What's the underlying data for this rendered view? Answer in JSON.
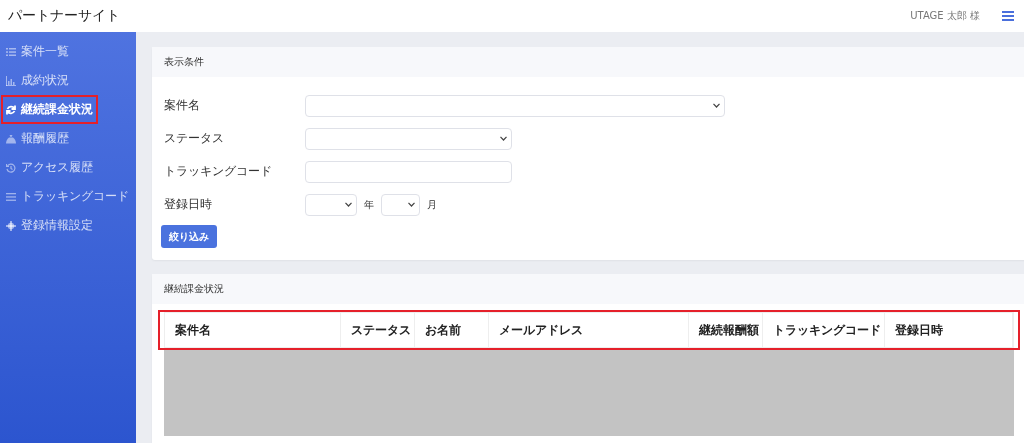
{
  "header": {
    "site_title": "パートナーサイト",
    "user": "UTAGE 太郎 様"
  },
  "sidebar": {
    "items": [
      {
        "label": "案件一覧",
        "selected": false,
        "highlighted": false
      },
      {
        "label": "成約状況",
        "selected": false,
        "highlighted": false
      },
      {
        "label": "継続課金状況",
        "selected": true,
        "highlighted": true
      },
      {
        "label": "報酬履歴",
        "selected": false,
        "highlighted": false
      },
      {
        "label": "アクセス履歴",
        "selected": false,
        "highlighted": false
      },
      {
        "label": "トラッキングコード",
        "selected": false,
        "highlighted": false
      },
      {
        "label": "登録情報設定",
        "selected": false,
        "highlighted": false
      }
    ]
  },
  "filter": {
    "title": "表示条件",
    "fields": [
      {
        "kind": "select",
        "label": "案件名"
      },
      {
        "kind": "select",
        "label": "ステータス"
      },
      {
        "kind": "text",
        "label": "トラッキングコード"
      },
      {
        "kind": "date",
        "label": "登録日時",
        "year_unit": "年",
        "month_unit": "月"
      }
    ],
    "button": "絞り込み"
  },
  "table_card": {
    "title": "継続課金状況",
    "header_highlighted": true,
    "columns": [
      "案件名",
      "ステータス",
      "お名前",
      "メールアドレス",
      "継続報酬額",
      "トラッキングコード",
      "登録日時"
    ],
    "rows_redacted": true
  }
}
